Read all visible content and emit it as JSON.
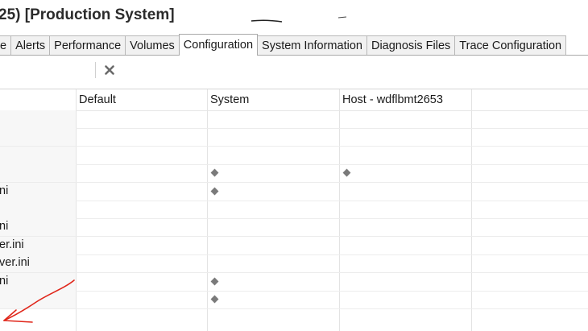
{
  "window": {
    "title": "25) [Production System]"
  },
  "tabs": [
    {
      "label": "e",
      "active": false
    },
    {
      "label": "Alerts",
      "active": false
    },
    {
      "label": "Performance",
      "active": false
    },
    {
      "label": "Volumes",
      "active": false
    },
    {
      "label": "Configuration",
      "active": true
    },
    {
      "label": "System Information",
      "active": false
    },
    {
      "label": "Diagnosis Files",
      "active": false
    },
    {
      "label": "Trace Configuration",
      "active": false
    }
  ],
  "toolbar": {
    "clear_icon": "close-icon"
  },
  "grid": {
    "columns": [
      "Default",
      "System",
      "Host - wdflbmt2653"
    ],
    "rows": [
      {
        "name": "",
        "system": false,
        "host": false
      },
      {
        "name": "",
        "system": false,
        "host": false
      },
      {
        "name": "",
        "system": false,
        "host": false
      },
      {
        "name": "",
        "system": true,
        "host": true
      },
      {
        "name": "ni",
        "system": true,
        "host": false
      },
      {
        "name": "",
        "system": false,
        "host": false
      },
      {
        "name": "ni",
        "system": false,
        "host": false
      },
      {
        "name": "er.ini",
        "system": false,
        "host": false
      },
      {
        "name": "ver.ini",
        "system": false,
        "host": false
      },
      {
        "name": "ni",
        "system": true,
        "host": false
      },
      {
        "name": "",
        "system": true,
        "host": false
      }
    ]
  },
  "colors": {
    "annotation": "#e0261a",
    "modified_marker": "#7a7a7a"
  }
}
